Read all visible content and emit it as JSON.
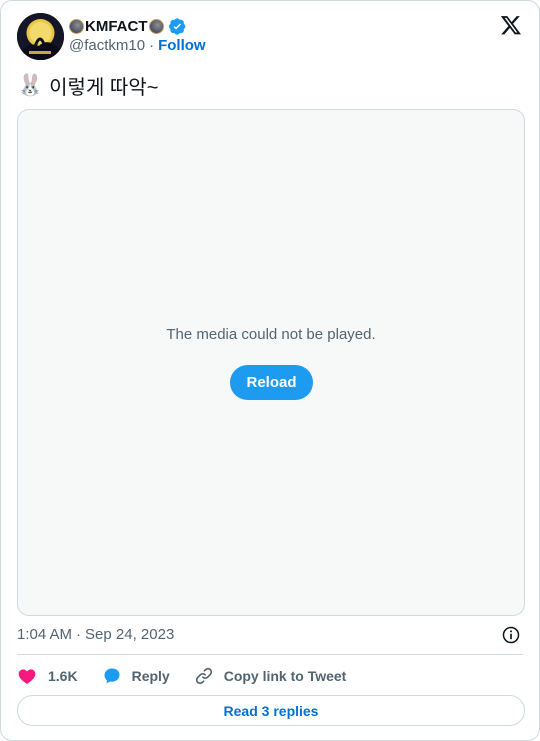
{
  "author": {
    "display_name": "KMFACT",
    "handle": "@factkm10",
    "separator": "·",
    "follow_label": "Follow",
    "verified": true
  },
  "tweet": {
    "emoji": "🐰",
    "text": "이렇게 따악~"
  },
  "media": {
    "error_message": "The media could not be played.",
    "reload_label": "Reload"
  },
  "meta": {
    "time": "1:04 AM",
    "separator": "·",
    "date": "Sep 24, 2023"
  },
  "actions": {
    "like_count": "1.6K",
    "reply_label": "Reply",
    "copy_link_label": "Copy link to Tweet"
  },
  "read_replies_label": "Read 3 replies",
  "colors": {
    "accent": "#1d9bf0",
    "link": "#006fd6",
    "like": "#f91880",
    "border": "#cfd9de",
    "muted": "#536471"
  }
}
